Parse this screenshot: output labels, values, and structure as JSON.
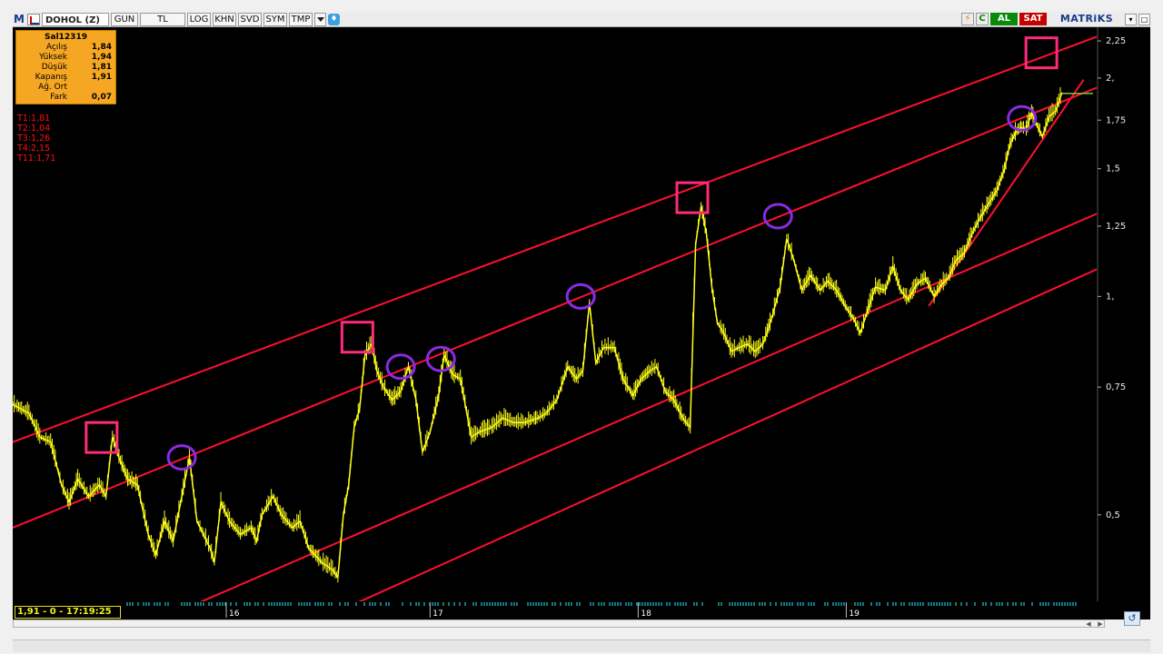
{
  "toolbar": {
    "logo": "M",
    "symbol": "DOHOL (Z)",
    "buttons": [
      "GUN",
      "TL",
      "LOG",
      "KHN",
      "SVD",
      "SYM",
      "TMP"
    ],
    "al_label": "AL",
    "sat_label": "SAT",
    "brand": "MATRiKS",
    "refresh_icon": "C"
  },
  "ohlc": {
    "title": "Sal12319",
    "rows": [
      {
        "label": "Açılış",
        "value": "1,84"
      },
      {
        "label": "Yüksek",
        "value": "1,94"
      },
      {
        "label": "Düşük",
        "value": "1,81"
      },
      {
        "label": "Kapanış",
        "value": "1,91"
      },
      {
        "label": "Ağ. Ort",
        "value": ""
      },
      {
        "label": "Fark",
        "value": "0,07"
      }
    ]
  },
  "trend_labels": [
    "T1:1,81",
    "T2:1,04",
    "T3:1,26",
    "T4:2,15",
    "T11:1,71"
  ],
  "status": "1,91 - 0 - 17:19:25",
  "colors": {
    "background": "#000000",
    "price": "#ffff1a",
    "channel": "#ff1030",
    "square_marker": "#ff2a7a",
    "circle_marker": "#8a2be2",
    "status_text": "#f0f020"
  },
  "chart_data": {
    "type": "line",
    "title": "",
    "xlabel": "",
    "ylabel": "",
    "scale": "log",
    "ylim": [
      0.38,
      2.35
    ],
    "xlim": [
      0,
      100
    ],
    "yticks": [
      {
        "value": 2.25,
        "label": "2,25"
      },
      {
        "value": 2.0,
        "label": "2,"
      },
      {
        "value": 1.75,
        "label": "1,75"
      },
      {
        "value": 1.5,
        "label": "1,5"
      },
      {
        "value": 1.25,
        "label": "1,25"
      },
      {
        "value": 1.0,
        "label": "1,"
      },
      {
        "value": 0.75,
        "label": "0,75"
      },
      {
        "value": 0.5,
        "label": "0,5"
      }
    ],
    "xticks": [
      {
        "x": 19.7,
        "label": "16"
      },
      {
        "x": 38.5,
        "label": "17"
      },
      {
        "x": 57.7,
        "label": "18"
      },
      {
        "x": 76.9,
        "label": "19"
      }
    ],
    "series": [
      {
        "values": [
          [
            0,
            0.71
          ],
          [
            1.5,
            0.69
          ],
          [
            2.5,
            0.64
          ],
          [
            3.5,
            0.63
          ],
          [
            4.5,
            0.55
          ],
          [
            5.2,
            0.52
          ],
          [
            6,
            0.56
          ],
          [
            7,
            0.53
          ],
          [
            8,
            0.55
          ],
          [
            8.6,
            0.53
          ],
          [
            9.2,
            0.64
          ],
          [
            9.8,
            0.6
          ],
          [
            10.6,
            0.56
          ],
          [
            11.5,
            0.55
          ],
          [
            12.5,
            0.47
          ],
          [
            13.2,
            0.44
          ],
          [
            14,
            0.49
          ],
          [
            14.8,
            0.46
          ],
          [
            15.6,
            0.53
          ],
          [
            16.3,
            0.6
          ],
          [
            17,
            0.49
          ],
          [
            18.2,
            0.45
          ],
          [
            18.6,
            0.43
          ],
          [
            19.2,
            0.52
          ],
          [
            20,
            0.49
          ],
          [
            21,
            0.47
          ],
          [
            22,
            0.48
          ],
          [
            22.5,
            0.46
          ],
          [
            23,
            0.5
          ],
          [
            24,
            0.53
          ],
          [
            24.8,
            0.5
          ],
          [
            25.8,
            0.48
          ],
          [
            26.5,
            0.49
          ],
          [
            27.3,
            0.45
          ],
          [
            28.5,
            0.43
          ],
          [
            29.5,
            0.42
          ],
          [
            30,
            0.41
          ],
          [
            30.5,
            0.5
          ],
          [
            31,
            0.55
          ],
          [
            31.5,
            0.66
          ],
          [
            32,
            0.7
          ],
          [
            32.5,
            0.83
          ],
          [
            33.1,
            0.86
          ],
          [
            33.6,
            0.79
          ],
          [
            34.2,
            0.75
          ],
          [
            35,
            0.72
          ],
          [
            35.8,
            0.74
          ],
          [
            36.5,
            0.8
          ],
          [
            37.2,
            0.72
          ],
          [
            37.8,
            0.61
          ],
          [
            38.5,
            0.65
          ],
          [
            39.3,
            0.73
          ],
          [
            39.8,
            0.83
          ],
          [
            40.6,
            0.78
          ],
          [
            41.3,
            0.77
          ],
          [
            42.3,
            0.64
          ],
          [
            43,
            0.65
          ],
          [
            44.2,
            0.66
          ],
          [
            45.2,
            0.68
          ],
          [
            46.2,
            0.67
          ],
          [
            47.2,
            0.67
          ],
          [
            48.5,
            0.68
          ],
          [
            49.2,
            0.69
          ],
          [
            50.2,
            0.72
          ],
          [
            51.2,
            0.8
          ],
          [
            52,
            0.77
          ],
          [
            52.6,
            0.79
          ],
          [
            53.2,
            0.98
          ],
          [
            53.8,
            0.81
          ],
          [
            54.5,
            0.85
          ],
          [
            55.5,
            0.85
          ],
          [
            56.3,
            0.77
          ],
          [
            57.2,
            0.73
          ],
          [
            58,
            0.77
          ],
          [
            58.8,
            0.79
          ],
          [
            59.4,
            0.8
          ],
          [
            60.2,
            0.74
          ],
          [
            61,
            0.72
          ],
          [
            61.8,
            0.68
          ],
          [
            62.5,
            0.66
          ],
          [
            63,
            1.18
          ],
          [
            63.5,
            1.33
          ],
          [
            64,
            1.22
          ],
          [
            64.5,
            1.03
          ],
          [
            65,
            0.92
          ],
          [
            65.6,
            0.89
          ],
          [
            66.3,
            0.84
          ],
          [
            67,
            0.85
          ],
          [
            67.8,
            0.86
          ],
          [
            68.5,
            0.84
          ],
          [
            69.2,
            0.86
          ],
          [
            70,
            0.93
          ],
          [
            70.8,
            1.03
          ],
          [
            71.4,
            1.2
          ],
          [
            72,
            1.13
          ],
          [
            72.8,
            1.02
          ],
          [
            73.6,
            1.07
          ],
          [
            74.5,
            1.02
          ],
          [
            75.2,
            1.05
          ],
          [
            76,
            1.02
          ],
          [
            76.8,
            0.97
          ],
          [
            77.6,
            0.93
          ],
          [
            78.2,
            0.89
          ],
          [
            78.8,
            0.95
          ],
          [
            79.6,
            1.03
          ],
          [
            80.5,
            1.02
          ],
          [
            81.2,
            1.1
          ],
          [
            81.9,
            1.02
          ],
          [
            82.6,
            0.99
          ],
          [
            83.4,
            1.04
          ],
          [
            84.2,
            1.06
          ],
          [
            85,
            1.0
          ],
          [
            85.7,
            1.04
          ],
          [
            86.3,
            1.06
          ],
          [
            87,
            1.12
          ],
          [
            87.8,
            1.15
          ],
          [
            88.5,
            1.22
          ],
          [
            89.2,
            1.28
          ],
          [
            90,
            1.34
          ],
          [
            90.8,
            1.4
          ],
          [
            91.5,
            1.5
          ],
          [
            92,
            1.62
          ],
          [
            92.5,
            1.68
          ],
          [
            93,
            1.71
          ],
          [
            93.5,
            1.7
          ],
          [
            94,
            1.79
          ],
          [
            94.5,
            1.72
          ],
          [
            95,
            1.66
          ],
          [
            95.6,
            1.77
          ],
          [
            96.2,
            1.8
          ],
          [
            96.8,
            1.91
          ]
        ]
      }
    ],
    "channel_lines": [
      {
        "x1": 0,
        "y1": 0.63,
        "x2": 100,
        "y2": 2.28
      },
      {
        "x1": 0,
        "y1": 0.48,
        "x2": 100,
        "y2": 1.94
      },
      {
        "x1": 8,
        "y1": 0.33,
        "x2": 100,
        "y2": 1.3
      },
      {
        "x1": 21,
        "y1": 0.32,
        "x2": 100,
        "y2": 1.09
      },
      {
        "x1": 84.5,
        "y1": 0.97,
        "x2": 98.8,
        "y2": 1.99
      }
    ],
    "square_markers": [
      {
        "x": 8.2,
        "y": 0.64
      },
      {
        "x": 31.8,
        "y": 0.88
      },
      {
        "x": 62.7,
        "y": 1.37
      },
      {
        "x": 94.9,
        "y": 2.17
      }
    ],
    "circle_markers": [
      {
        "x": 15.6,
        "y": 0.6
      },
      {
        "x": 35.8,
        "y": 0.8
      },
      {
        "x": 39.5,
        "y": 0.82
      },
      {
        "x": 52.4,
        "y": 1.0
      },
      {
        "x": 70.6,
        "y": 1.29
      },
      {
        "x": 93.1,
        "y": 1.76
      }
    ]
  }
}
